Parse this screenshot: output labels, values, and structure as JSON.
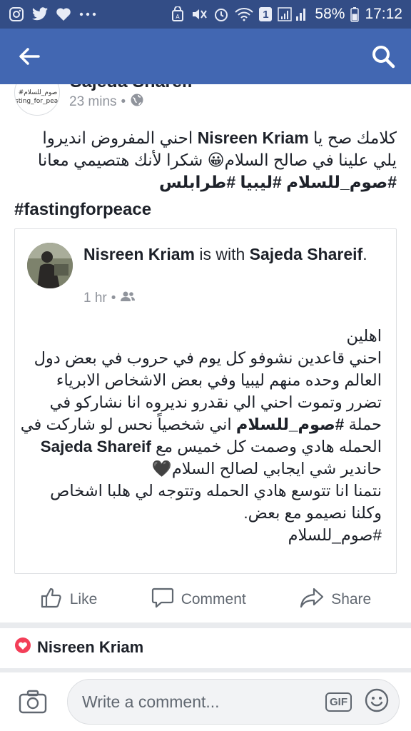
{
  "status_bar": {
    "notification_icons": [
      "instagram-icon",
      "twitter-icon",
      "heart-icon",
      "more-icon"
    ],
    "system_icons": [
      "nfc-icon",
      "mute-icon",
      "alarm-icon",
      "wifi-icon",
      "sim-icon",
      "signal-icon"
    ],
    "sim_label": "1",
    "battery": "58%",
    "time": "17:12"
  },
  "app_bar": {
    "icons": [
      "back-arrow-icon",
      "search-icon"
    ]
  },
  "post": {
    "author": "Sajeda Shareif",
    "avatar_lines": [
      "#صوم_للسلام",
      "sting_for_peac"
    ],
    "time": "23 mins",
    "privacy_icon": "globe-icon",
    "body_line1_prefix": "كلامك صح يا ",
    "body_mention": "Nisreen Kriam",
    "body_line1_suffix": " احني المفروض انديروا",
    "body_line2": "يلي علينا في صالح السلام😀 شكرا لأنك هتصيمي معانا",
    "hashtags_ar": [
      "#صوم_للسلام",
      "#ليبيا",
      "#طرابلس"
    ],
    "hashtag_en": "#fastingforpeace"
  },
  "shared": {
    "author": "Nisreen Kriam",
    "with_text": " is with ",
    "with_name": "Sajeda Shareif",
    "period": ".",
    "time": "1 hr",
    "audience_icon": "friends-icon",
    "lines": [
      "اهلين",
      "احني قاعدين نشوفو كل يوم في حروب في بعض دول",
      "العالم وحده منهم ليبيا وفي بعض الاشخاص الابرياء",
      "تضرر وتموت احني الي نقدرو نديروه انا نشاركو في"
    ],
    "line5_prefix": "حملة ",
    "line5_hashtag": "#صوم_للسلام",
    "line5_suffix": "  اني شخصياً نحس لو شاركت في",
    "line6_prefix": "الحمله هادي وصمت كل خميس مع ",
    "line6_mention": "Sajeda Shareif",
    "line7": "حاندير شي ايجابي لصالح السلام🖤",
    "line8": "نتمنا انا تتوسع هادي الحمله وتتوجه لي هلبا اشخاص",
    "line9": "وكلنا نصيمو مع بعض.",
    "line10": "#صوم_للسلام"
  },
  "actions": {
    "like": "Like",
    "comment": "Comment",
    "share": "Share"
  },
  "reactions": {
    "icon": "love-reaction-icon",
    "name": "Nisreen Kriam"
  },
  "composer": {
    "placeholder": "Write a comment...",
    "gif_label": "GIF",
    "icons": [
      "camera-icon",
      "gif-icon",
      "smiley-icon"
    ]
  },
  "colors": {
    "status_bar": "#334d86",
    "app_bar": "#4267b2",
    "text": "#1d2129",
    "meta": "#90949c",
    "love": "#f33e58"
  }
}
